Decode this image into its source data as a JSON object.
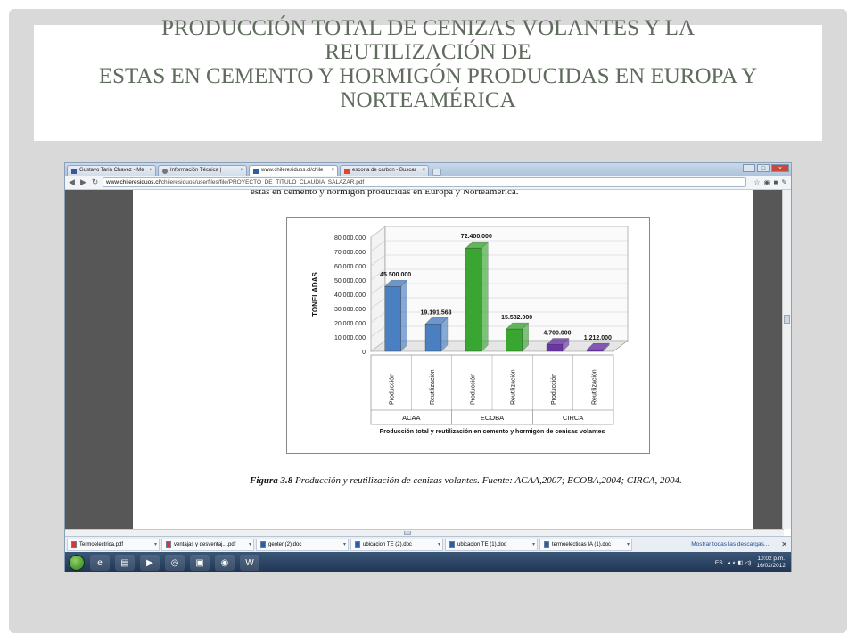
{
  "slide": {
    "title_lines": [
      "PRODUCCIÓN TOTAL DE CENIZAS VOLANTES Y LA",
      "REUTILIZACIÓN DE",
      "ESTAS EN CEMENTO Y HORMIGÓN PRODUCIDAS EN EUROPA Y",
      "NORTEAMÉRICA"
    ]
  },
  "browser": {
    "tabs": [
      {
        "label": "Gustavo Tarin Chavez - Me",
        "active": false
      },
      {
        "label": "Información Técnica |",
        "active": false
      },
      {
        "label": "www.chileresiduos.cl/chile",
        "active": true
      },
      {
        "label": "escoria de carbon - Buscar",
        "active": false
      }
    ],
    "url_host": "www.chileresiduos.cl",
    "url_path": "/chileresiduos/userfiles/file/PROYECTO_DE_TITULO_CLAUDIA_SALAZAR.pdf",
    "page_top_text": "estas en cemento y hormigón producidas en Europa y Norteamérica.",
    "caption_bold": "Figura 3.8",
    "caption_text": " Producción y reutilización de cenizas volantes. Fuente: ACAA,2007; ECOBA,2004; CIRCA, 2004."
  },
  "chart_data": {
    "type": "bar",
    "ylabel": "TONELADAS",
    "xlabel": "Producción total y reutilización en cemento y hormigón de cenisas volantes",
    "ylim": [
      0,
      80000000
    ],
    "yticks": [
      "80.000.000",
      "70.000.000",
      "60.000.000",
      "50.000.000",
      "40.000.000",
      "30.000.000",
      "20.000.000",
      "10.000.000",
      "0"
    ],
    "groups": [
      "ACAA",
      "ECOBA",
      "CIRCA"
    ],
    "categories": [
      "Producción",
      "Reutilización",
      "Producción",
      "Reutilización",
      "Producción",
      "Reutilización"
    ],
    "values": [
      45500000,
      19191563,
      72400000,
      15582000,
      4700000,
      1212000
    ],
    "labels": [
      "45.500.000",
      "19.191.563",
      "72.400.000",
      "15.582.000",
      "4.700.000",
      "1.212.000"
    ],
    "colors": [
      "#4a7fc1",
      "#4a7fc1",
      "#3aa632",
      "#3aa632",
      "#6a35a8",
      "#6a35a8"
    ]
  },
  "downloads": {
    "items": [
      "Termoelectrica.pdf",
      "ventajas y desventaj....pdf",
      "geoter (2).doc",
      "ubicacion TE (2).doc",
      "ubicacion TE (1).doc",
      "termoelecticas IA (1).doc"
    ],
    "show_all": "Mostrar todas las descargas..."
  },
  "taskbar": {
    "lang": "ES",
    "time": "10:02 p.m.",
    "date": "16/02/2012"
  }
}
